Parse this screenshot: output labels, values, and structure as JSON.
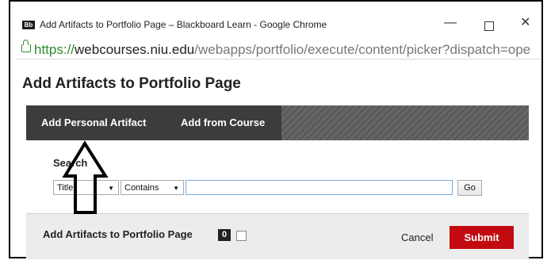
{
  "window": {
    "favicon": "Bb",
    "title": "Add Artifacts to Portfolio Page – Blackboard Learn - Google Chrome",
    "minimize_glyph": "—",
    "close_glyph": "✕"
  },
  "address": {
    "protocol": "https://",
    "host": "webcourses.niu.edu",
    "path": "/webapps/portfolio/execute/content/picker?dispatch=ope"
  },
  "page": {
    "title": "Add Artifacts to Portfolio Page",
    "tabs": [
      {
        "label": "Add Personal Artifact"
      },
      {
        "label": "Add from Course"
      }
    ]
  },
  "search": {
    "label": "Search",
    "field_select": "Title",
    "operator_select": "Contains",
    "input_value": "",
    "go_label": "Go"
  },
  "footer": {
    "title": "Add Artifacts to Portfolio Page",
    "count": "0",
    "cancel_label": "Cancel",
    "submit_label": "Submit"
  },
  "colors": {
    "submit": "#c20b10",
    "tabbar": "#3c3c3c",
    "secure_green": "#2e8b2e"
  },
  "annotation": {
    "icon": "up-arrow-icon"
  }
}
